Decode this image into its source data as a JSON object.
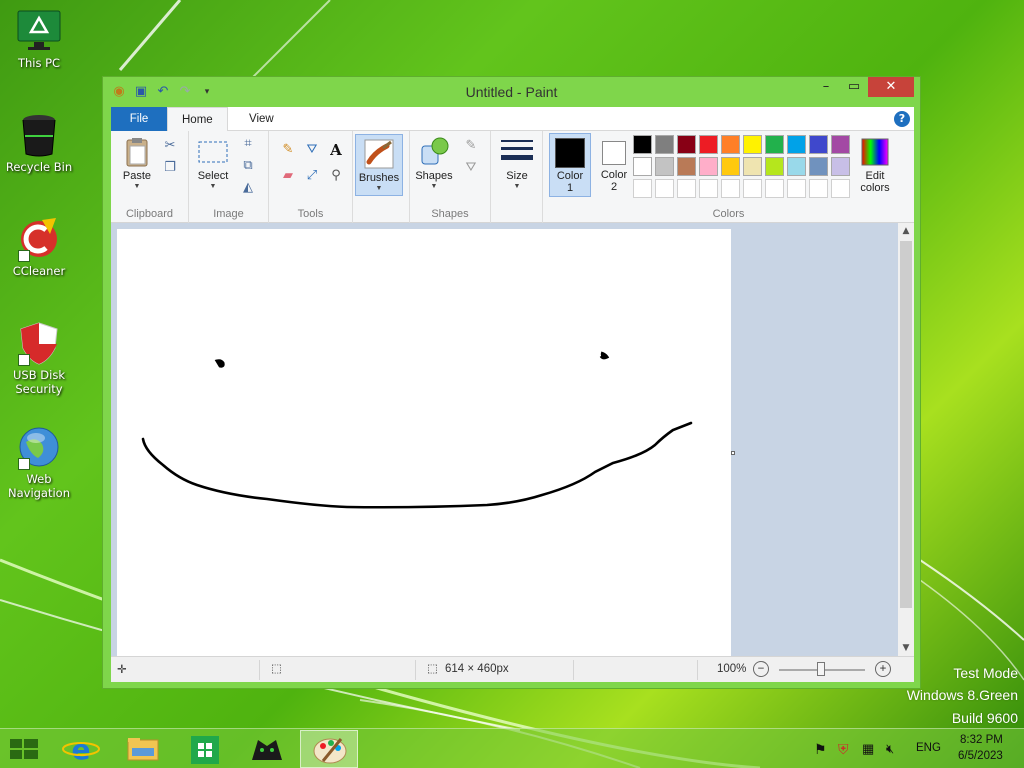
{
  "desktop": {
    "icons": [
      {
        "label": "This PC",
        "icon": "monitor-icon"
      },
      {
        "label": "Recycle Bin",
        "icon": "recycle-bin-icon"
      },
      {
        "label": "CCleaner",
        "icon": "ccleaner-icon"
      },
      {
        "label": "USB Disk Security",
        "icon": "shield-icon"
      },
      {
        "label": "Web Navigation",
        "icon": "globe-icon"
      }
    ],
    "watermark": [
      "Test Mode",
      "Windows 8.Green",
      "Build 9600"
    ]
  },
  "window": {
    "title": "Untitled - Paint",
    "tabs": {
      "file": "File",
      "home": "Home",
      "view": "View"
    },
    "help": "?"
  },
  "ribbon": {
    "clipboard": {
      "label": "Clipboard",
      "paste": "Paste"
    },
    "image": {
      "label": "Image",
      "select": "Select"
    },
    "tools": {
      "label": "Tools",
      "text_tool": "A"
    },
    "brushes": {
      "label": "Brushes"
    },
    "shapes": {
      "label": "Shapes",
      "shapes_btn": "Shapes"
    },
    "size": {
      "label": "Size"
    },
    "colors": {
      "label": "Colors",
      "color1": [
        "Color",
        "1"
      ],
      "color2": [
        "Color",
        "2"
      ],
      "edit": [
        "Edit",
        "colors"
      ],
      "color1_value": "#000000",
      "color2_value": "#ffffff",
      "palette_row1": [
        "#000000",
        "#7f7f7f",
        "#880015",
        "#ed1c24",
        "#ff7f27",
        "#fff200",
        "#22b14c",
        "#00a2e8",
        "#3f48cc",
        "#a349a4"
      ],
      "palette_row2": [
        "#ffffff",
        "#c3c3c3",
        "#b97a57",
        "#ffaec9",
        "#ffc90e",
        "#efe4b0",
        "#b5e61d",
        "#99d9ea",
        "#7092be",
        "#c8bfe7"
      ],
      "palette_row3": [
        "#ffffff",
        "#ffffff",
        "#ffffff",
        "#ffffff",
        "#ffffff",
        "#ffffff",
        "#ffffff",
        "#ffffff",
        "#ffffff",
        "#ffffff"
      ]
    }
  },
  "statusbar": {
    "canvas_size": "614 × 460px",
    "zoom": "100%"
  },
  "taskbar": {
    "language": "ENG",
    "time": "8:32 PM",
    "date": "6/5/2023",
    "apps": [
      "start-icon",
      "internet-explorer-icon",
      "file-explorer-icon",
      "store-icon",
      "app-icon",
      "paint-icon"
    ]
  }
}
